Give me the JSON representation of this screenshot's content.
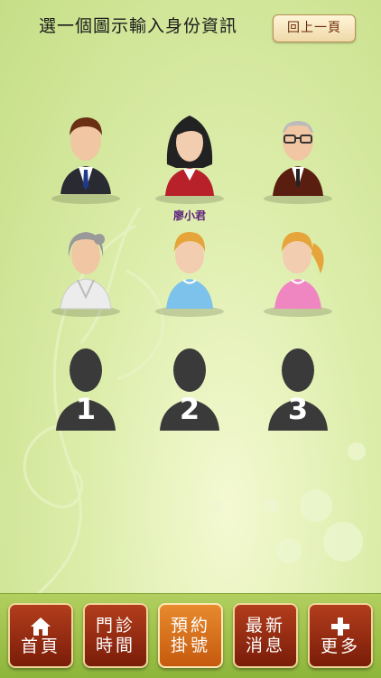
{
  "header": {
    "title": "選一個圖示輸入身份資訊",
    "back_label": "回上一頁"
  },
  "avatars": [
    {
      "kind": "man-suit"
    },
    {
      "kind": "woman-red",
      "label": "廖小君"
    },
    {
      "kind": "old-man"
    },
    {
      "kind": "old-woman"
    },
    {
      "kind": "boy"
    },
    {
      "kind": "girl"
    },
    {
      "kind": "silhouette",
      "number": "1"
    },
    {
      "kind": "silhouette",
      "number": "2"
    },
    {
      "kind": "silhouette",
      "number": "3"
    }
  ],
  "tabbar": {
    "items": [
      {
        "icon": "home-icon",
        "line1": "",
        "line2": "首頁"
      },
      {
        "icon": "",
        "line1": "門診",
        "line2": "時間"
      },
      {
        "icon": "",
        "line1": "預約",
        "line2": "掛號"
      },
      {
        "icon": "",
        "line1": "最新",
        "line2": "消息"
      },
      {
        "icon": "plus-icon",
        "line1": "",
        "line2": "更多"
      }
    ]
  },
  "colors": {
    "background": "#d9eca6",
    "tab_red": "#9a2c12",
    "tab_active": "#d96f1c",
    "label_purple": "#5a1e7a"
  }
}
